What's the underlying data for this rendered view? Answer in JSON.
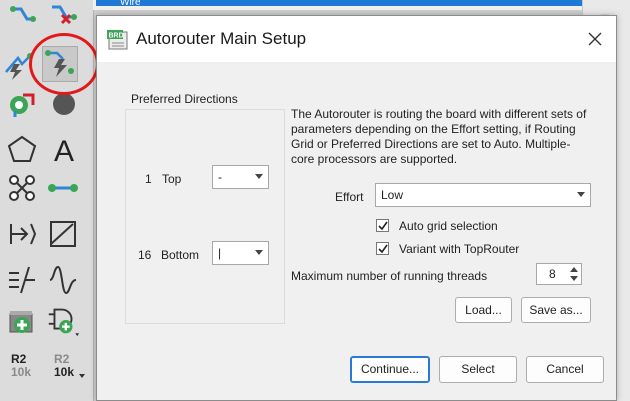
{
  "background_window": {
    "title": "Wire"
  },
  "toolbar": {
    "tools": [
      {
        "name": "route-icon"
      },
      {
        "name": "ripup-icon"
      },
      {
        "name": "autorouter-icon"
      },
      {
        "name": "autorouter-selected-icon"
      },
      {
        "name": "via-icon"
      },
      {
        "name": "hole-icon"
      },
      {
        "name": "polygon-icon"
      },
      {
        "name": "text-icon"
      },
      {
        "name": "signal-icon"
      },
      {
        "name": "wire-icon"
      },
      {
        "name": "meander-icon"
      },
      {
        "name": "miter-icon"
      },
      {
        "name": "dimension-icon"
      },
      {
        "name": "optimize-icon"
      },
      {
        "name": "add-part-icon"
      },
      {
        "name": "gate-icon"
      }
    ],
    "r2_tool": {
      "top": "R2",
      "bottom": "10k"
    },
    "r2_tool_dim": {
      "top": "R2",
      "bottom": "10k"
    },
    "highlight_color": "#e01a1a"
  },
  "dialog": {
    "title": "Autorouter Main Setup",
    "icon_text": "BRD",
    "preferred_directions": {
      "label": "Preferred Directions",
      "layers": [
        {
          "number": "1",
          "name": "Top",
          "value": "-"
        },
        {
          "number": "16",
          "name": "Bottom",
          "value": "|"
        }
      ]
    },
    "description": "The Autorouter is routing the board with different sets of parameters depending on the Effort setting, if Routing Grid or Preferred Directions are set to Auto. Multiple-core processors are supported.",
    "effort": {
      "label": "Effort",
      "value": "Low"
    },
    "checkboxes": [
      {
        "label": "Auto grid selection",
        "checked": true
      },
      {
        "label": "Variant with TopRouter",
        "checked": true
      }
    ],
    "threads": {
      "label": "Maximum number of running threads",
      "value": "8"
    },
    "buttons": {
      "load": "Load...",
      "save_as": "Save as...",
      "continue": "Continue...",
      "select": "Select",
      "cancel": "Cancel"
    }
  }
}
